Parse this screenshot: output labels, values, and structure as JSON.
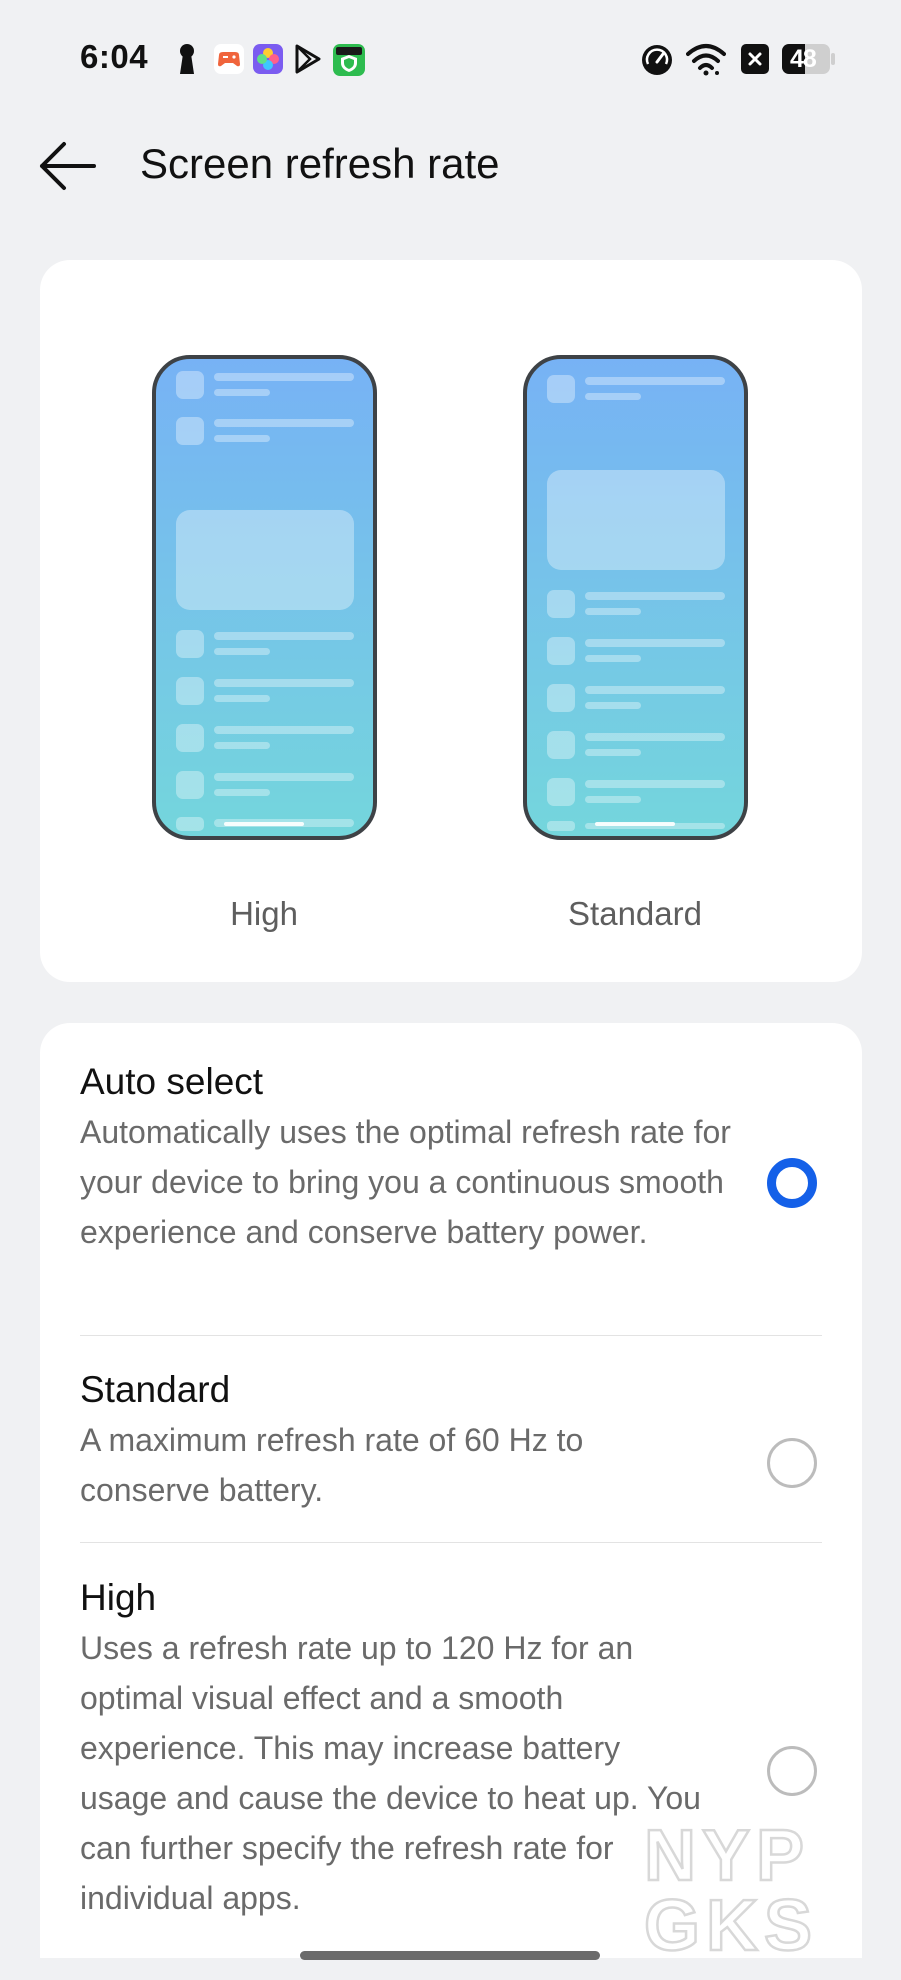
{
  "status_bar": {
    "time": "6:04",
    "battery": "48",
    "left_icons": [
      "keyhole-icon",
      "game-icon",
      "photos-icon",
      "play-store-icon",
      "vpn-shield-icon"
    ],
    "right_icons": [
      "speedometer-icon",
      "wifi-icon",
      "close-box-icon",
      "battery-icon"
    ]
  },
  "header": {
    "title": "Screen refresh rate",
    "back_icon": "arrow-left-icon"
  },
  "preview": {
    "high_label": "High",
    "standard_label": "Standard"
  },
  "options": [
    {
      "title": "Auto select",
      "description": "Automatically uses the optimal refresh rate for your device to bring you a continuous smooth experience and conserve battery power.",
      "selected": true
    },
    {
      "title": "Standard",
      "description": "A maximum refresh rate of 60 Hz to conserve battery.",
      "selected": false
    },
    {
      "title": "High",
      "description": "Uses a refresh rate up to 120 Hz for an optimal visual effect and a smooth experience. This may increase battery usage and cause the device to heat up. You can further specify the refresh rate for individual apps.",
      "selected": false
    }
  ],
  "colors": {
    "accent": "#1460e8",
    "background": "#f0f1f3",
    "card": "#ffffff"
  },
  "watermark": {
    "line1": "NYP",
    "line2": "GKS"
  }
}
